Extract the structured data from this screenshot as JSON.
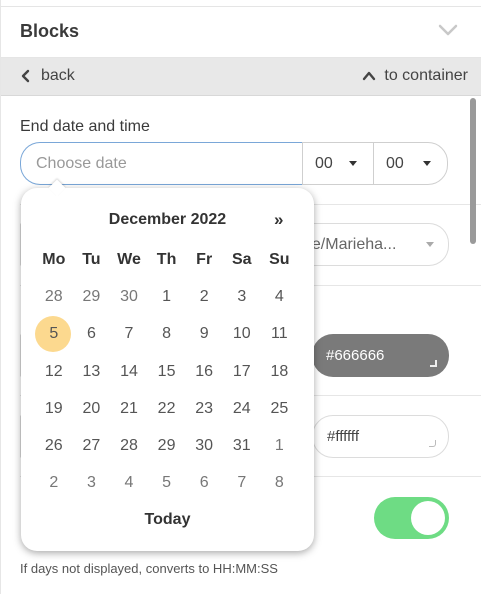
{
  "header": {
    "title": "Blocks",
    "collapse_icon": "chevron-down-icon"
  },
  "nav": {
    "back_label": "back",
    "back_icon": "chevron-left-icon",
    "container_label": "to container",
    "container_icon": "chevron-up-icon"
  },
  "end_date": {
    "label": "End date and time",
    "placeholder": "Choose date",
    "hour": "00",
    "minute": "00"
  },
  "timezone": {
    "value": "pe/Marieha..."
  },
  "colors": {
    "dark_value": "#666666",
    "light_value": "#ffffff",
    "toggle_on_color": "#6edc84"
  },
  "hint": "If days not displayed, converts to HH:MM:SS",
  "calendar": {
    "month": "December 2022",
    "next": "»",
    "weekdays": [
      "Mo",
      "Tu",
      "We",
      "Th",
      "Fr",
      "Sa",
      "Su"
    ],
    "weeks": [
      [
        {
          "d": "28",
          "m": true
        },
        {
          "d": "29",
          "m": true
        },
        {
          "d": "30",
          "m": true
        },
        {
          "d": "1"
        },
        {
          "d": "2"
        },
        {
          "d": "3"
        },
        {
          "d": "4"
        }
      ],
      [
        {
          "d": "5",
          "s": true
        },
        {
          "d": "6"
        },
        {
          "d": "7"
        },
        {
          "d": "8"
        },
        {
          "d": "9"
        },
        {
          "d": "10"
        },
        {
          "d": "11"
        }
      ],
      [
        {
          "d": "12"
        },
        {
          "d": "13"
        },
        {
          "d": "14"
        },
        {
          "d": "15"
        },
        {
          "d": "16"
        },
        {
          "d": "17"
        },
        {
          "d": "18"
        }
      ],
      [
        {
          "d": "19"
        },
        {
          "d": "20"
        },
        {
          "d": "21"
        },
        {
          "d": "22"
        },
        {
          "d": "23"
        },
        {
          "d": "24"
        },
        {
          "d": "25"
        }
      ],
      [
        {
          "d": "26"
        },
        {
          "d": "27"
        },
        {
          "d": "28"
        },
        {
          "d": "29"
        },
        {
          "d": "30"
        },
        {
          "d": "31"
        },
        {
          "d": "1",
          "m": true
        }
      ],
      [
        {
          "d": "2",
          "m": true
        },
        {
          "d": "3",
          "m": true
        },
        {
          "d": "4",
          "m": true
        },
        {
          "d": "5",
          "m": true
        },
        {
          "d": "6",
          "m": true
        },
        {
          "d": "7",
          "m": true
        },
        {
          "d": "8",
          "m": true
        }
      ]
    ],
    "today_label": "Today",
    "selected_color": "#fcd98f"
  }
}
